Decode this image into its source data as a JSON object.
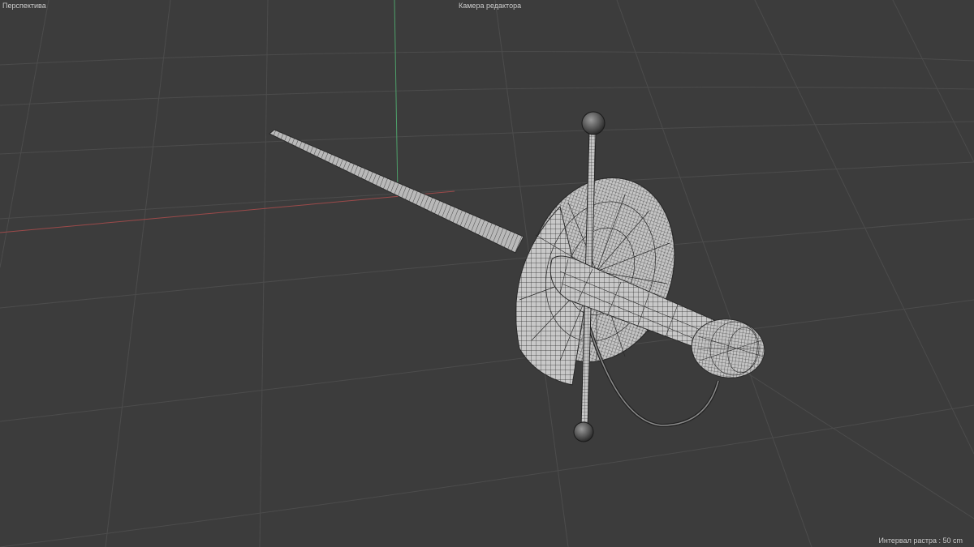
{
  "viewport": {
    "view_name": "Перспектива",
    "camera_label": "Камера редактора",
    "grid_spacing": "Интервал растра : 50 cm"
  },
  "scene": {
    "object": "rapier-sword",
    "display_mode": "wireframe-shaded"
  },
  "colors": {
    "background": "#3c3c3c",
    "grid_line": "#4d4d4d",
    "x_axis": "#a04b4b",
    "y_axis": "#4ea06a",
    "wire": "#2a2a2a",
    "shade": "#c9c9c9"
  }
}
